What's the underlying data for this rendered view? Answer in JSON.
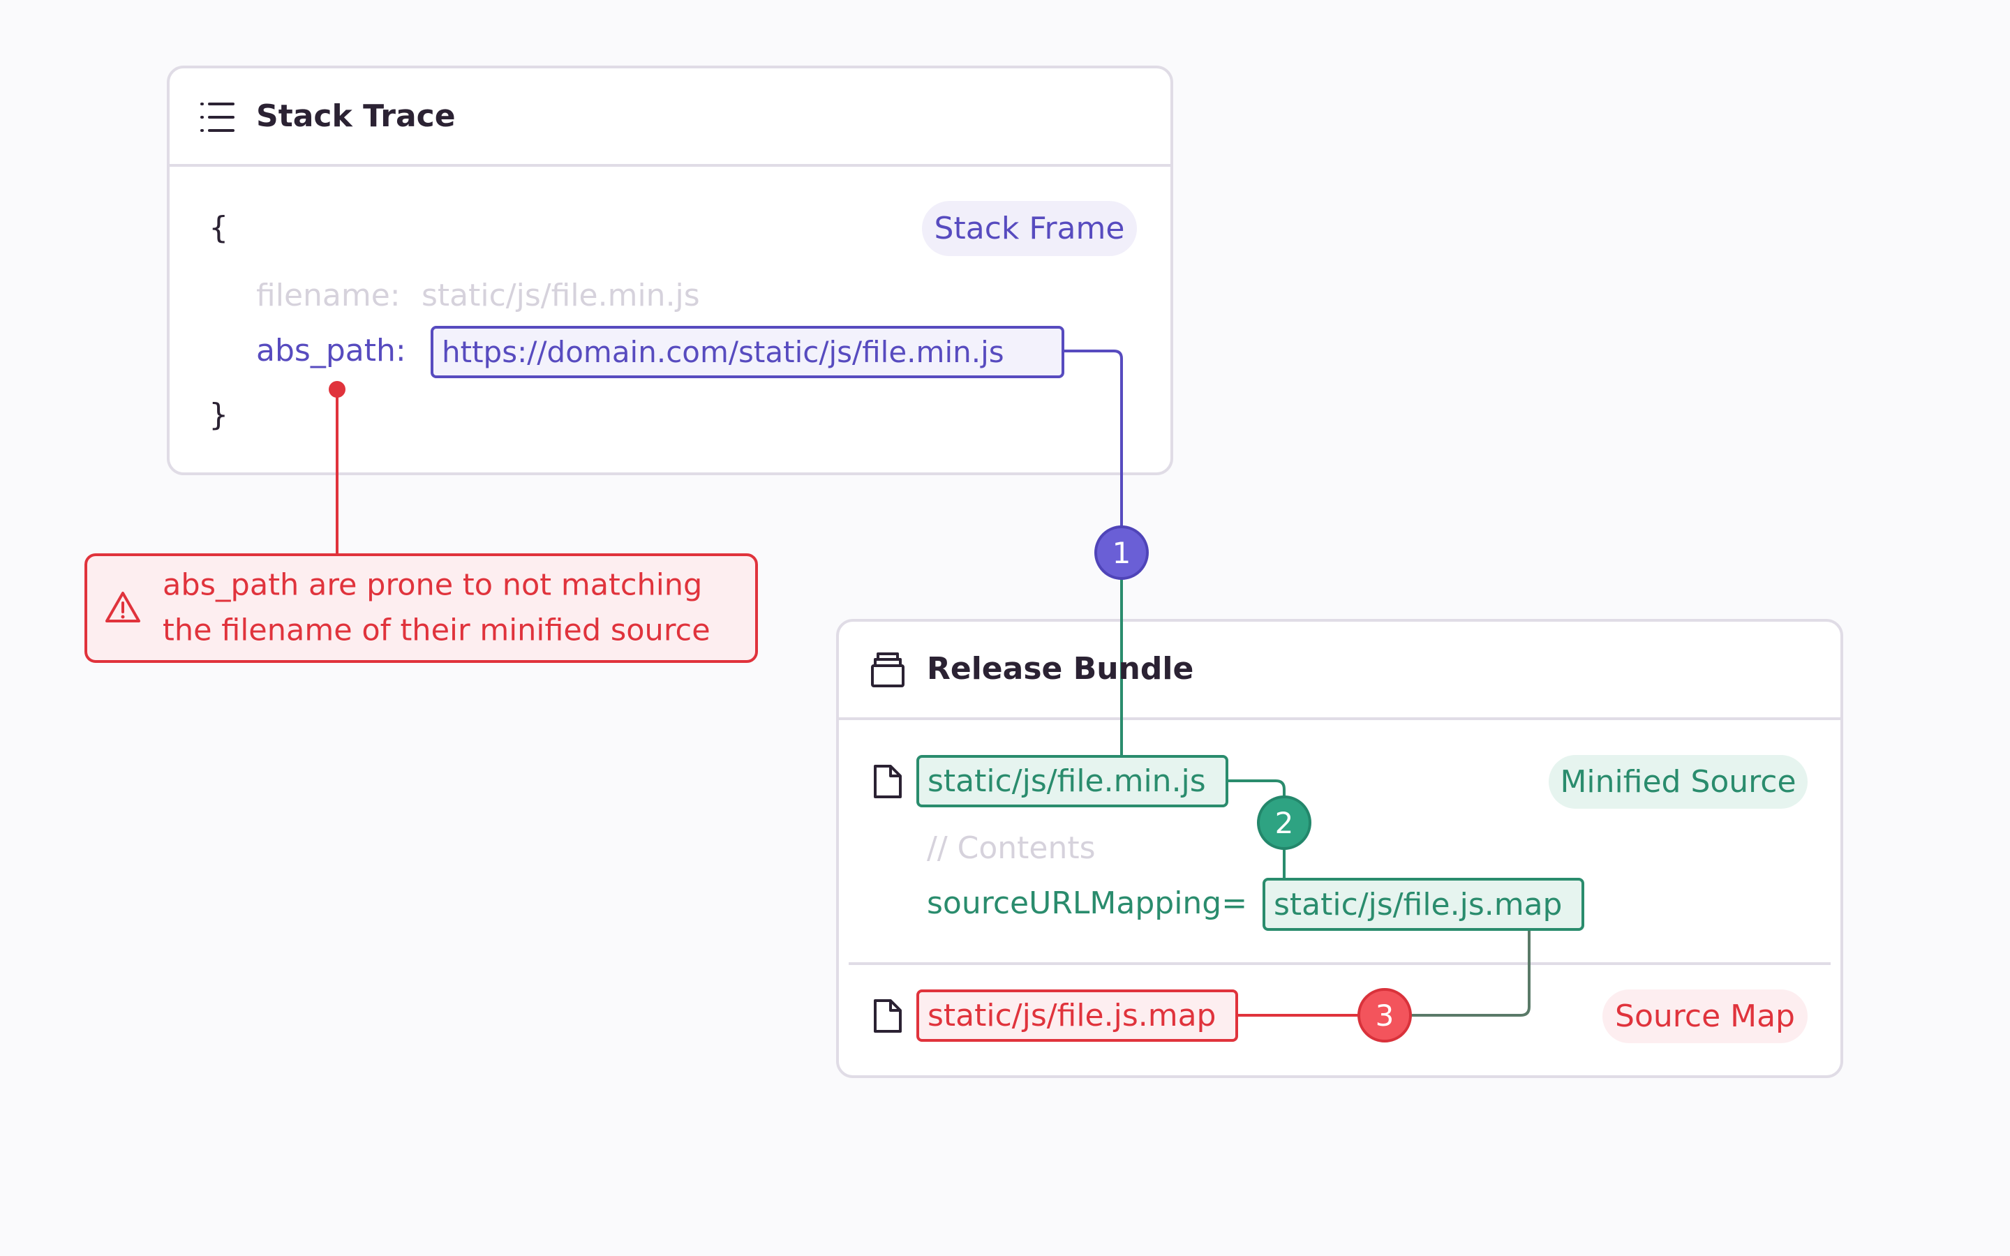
{
  "colors": {
    "purple": "#574bbf",
    "green": "#2a8c6d",
    "red": "#e0333c",
    "border": "#e0dce6"
  },
  "stack_trace": {
    "icon": "list-icon",
    "title": "Stack Trace",
    "open_brace": "{",
    "close_brace": "}",
    "badge": "Stack Frame",
    "filename_key": "filename:",
    "filename_value": "static/js/file.min.js",
    "abs_path_key": "abs_path:",
    "abs_path_value": "https://domain.com/static/js/file.min.js"
  },
  "warning": {
    "icon": "warning-triangle-icon",
    "line1": "abs_path are prone to not matching",
    "line2": "the filename of their minified source"
  },
  "steps": [
    "1",
    "2",
    "3"
  ],
  "release_bundle": {
    "icon": "archive-box-icon",
    "title": "Release Bundle",
    "minified_file": "static/js/file.min.js",
    "minified_badge": "Minified Source",
    "contents_comment": "// Contents",
    "mapping_key": "sourceURLMapping=",
    "mapping_value": "static/js/file.js.map",
    "map_file": "static/js/file.js.map",
    "map_badge": "Source Map"
  }
}
